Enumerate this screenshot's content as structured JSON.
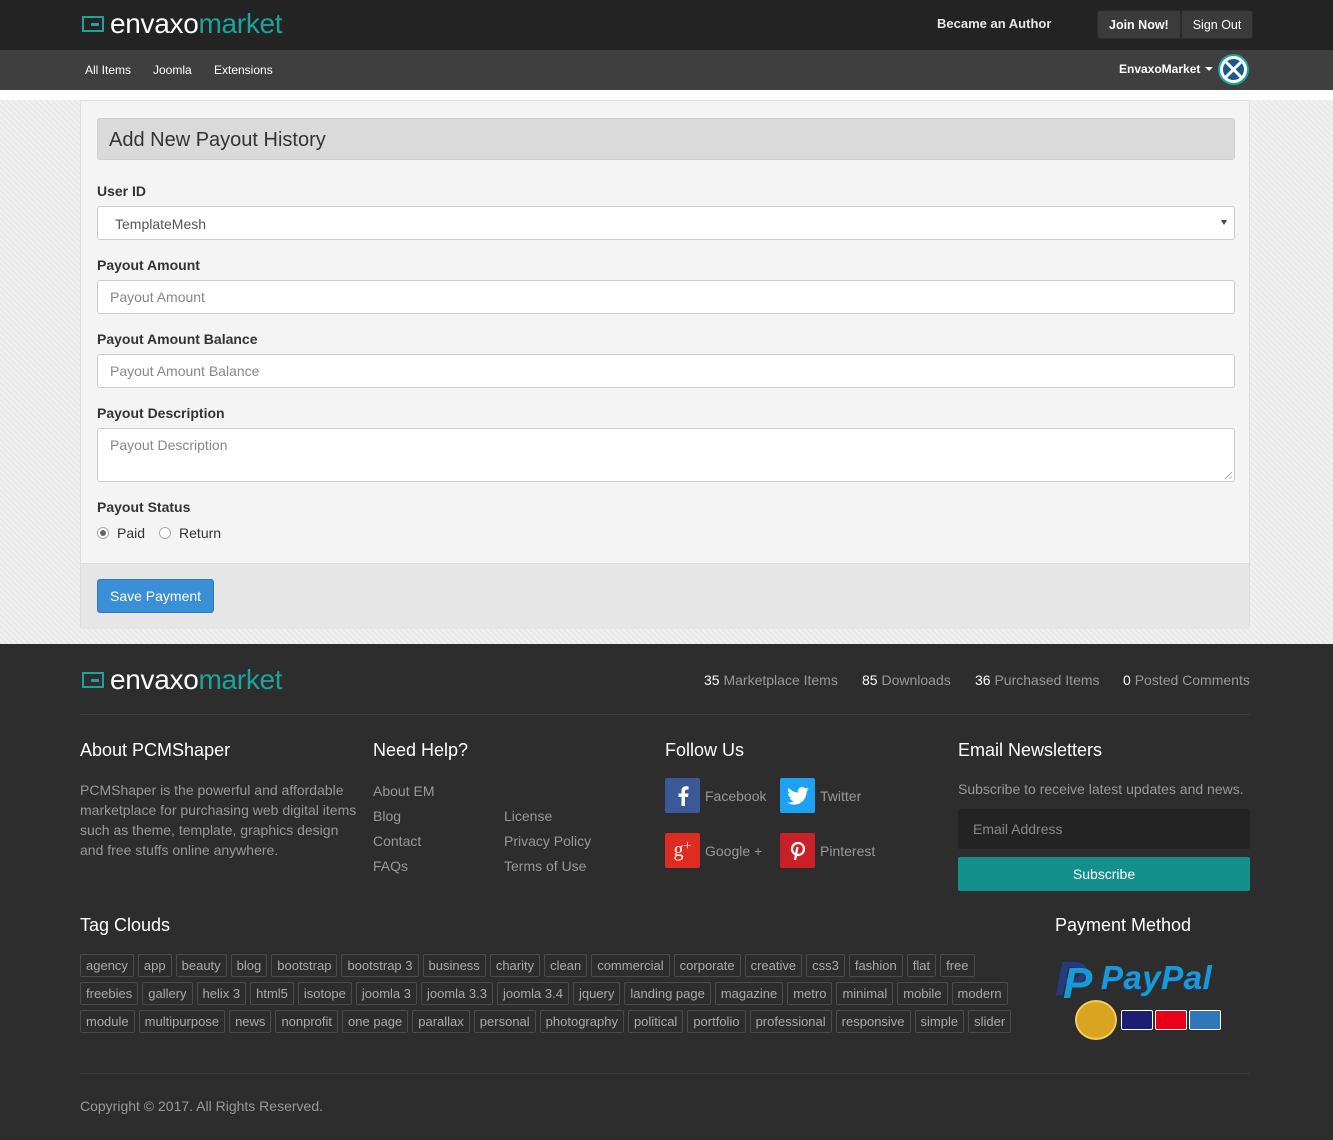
{
  "brand": {
    "name_white": "envaxo",
    "name_teal": "market"
  },
  "colors": {
    "accent": "#1ba39c",
    "primary": "#3a8fd6",
    "subscribe": "#13908b",
    "dark": "#232323"
  },
  "header": {
    "became_author": "Became an Author",
    "join_now": "Join Now!",
    "sign_out": "Sign Out"
  },
  "nav": {
    "items": [
      "All Items",
      "Joomla",
      "Extensions"
    ],
    "user": "EnvaxoMarket"
  },
  "form": {
    "title": "Add New Payout History",
    "user_id_label": "User ID",
    "user_id_value": "TemplateMesh",
    "payout_amount_label": "Payout Amount",
    "payout_amount_placeholder": "Payout Amount",
    "payout_balance_label": "Payout Amount Balance",
    "payout_balance_placeholder": "Payout Amount Balance",
    "payout_description_label": "Payout Description",
    "payout_description_placeholder": "Payout Description",
    "payout_status_label": "Payout Status",
    "status_options": [
      "Paid",
      "Return"
    ],
    "status_selected": "Paid",
    "save_button": "Save Payment"
  },
  "footer": {
    "stats": [
      {
        "count": "35",
        "label": "Marketplace Items"
      },
      {
        "count": "85",
        "label": "Downloads"
      },
      {
        "count": "36",
        "label": "Purchased Items"
      },
      {
        "count": "0",
        "label": "Posted Comments"
      }
    ],
    "about_title": "About PCMShaper",
    "about_text": "PCMShaper is the powerful and affordable marketplace for purchasing web digital items such as theme, template, graphics design and free stuffs online anywhere.",
    "help_title": "Need Help?",
    "help_links_col1": [
      "About EM",
      "Blog",
      "Contact",
      "FAQs"
    ],
    "help_links_col2": [
      "License",
      "Privacy Policy",
      "Terms of Use"
    ],
    "follow_title": "Follow Us",
    "social": [
      {
        "label": "Facebook",
        "icon": "facebook-icon",
        "color": "#3b5998"
      },
      {
        "label": "Twitter",
        "icon": "twitter-icon",
        "color": "#1da1f2"
      },
      {
        "label": "Google +",
        "icon": "google-plus-icon",
        "color": "#dd2d22"
      },
      {
        "label": "Pinterest",
        "icon": "pinterest-icon",
        "color": "#cb2027"
      }
    ],
    "newsletter_title": "Email Newsletters",
    "newsletter_text": "Subscribe to receive latest updates and news.",
    "email_placeholder": "Email Address",
    "subscribe_button": "Subscribe",
    "tags_title": "Tag Clouds",
    "tags": [
      "agency",
      "app",
      "beauty",
      "blog",
      "bootstrap",
      "bootstrap 3",
      "business",
      "charity",
      "clean",
      "commercial",
      "corporate",
      "creative",
      "css3",
      "fashion",
      "flat",
      "free",
      "freebies",
      "gallery",
      "helix 3",
      "html5",
      "isotope",
      "joomla 3",
      "joomla 3.3",
      "joomla 3.4",
      "jquery",
      "landing page",
      "magazine",
      "metro",
      "minimal",
      "mobile",
      "modern",
      "module",
      "multipurpose",
      "news",
      "nonprofit",
      "one page",
      "parallax",
      "personal",
      "photography",
      "political",
      "portfolio",
      "professional",
      "responsive",
      "simple",
      "slider"
    ],
    "payment_title": "Payment Method",
    "paypal_text": "PayPal",
    "copyright": "Copyright © 2017. All Rights Reserved."
  }
}
